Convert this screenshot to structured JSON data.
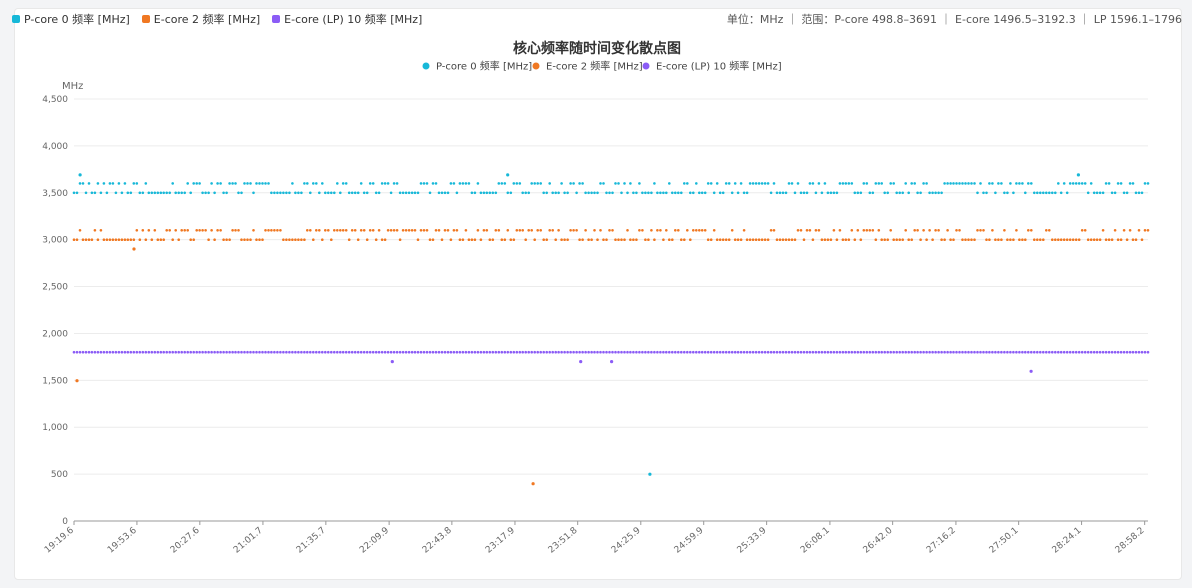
{
  "top_legend": [
    {
      "label": "P-core 0 频率 [MHz]",
      "color": "#17b8d8"
    },
    {
      "label": "E-core 2 频率 [MHz]",
      "color": "#f07822"
    },
    {
      "label": "E-core (LP) 10 频率 [MHz]",
      "color": "#8b5cf6"
    }
  ],
  "range_info": "单位：MHz ｜ 范围：P-core 498.8–3691 ｜ E-core 1496.5–3192.3 ｜ LP 1596.1–1796",
  "chart_data": {
    "type": "scatter",
    "title": "核心频率随时间变化散点图",
    "ylabel": "MHz",
    "xlabel": "",
    "ylim": [
      0,
      4500
    ],
    "yticks": [
      "0",
      "500",
      "1,000",
      "1,500",
      "2,000",
      "2,500",
      "3,000",
      "3,500",
      "4,000",
      "4,500"
    ],
    "xticks": [
      "19:19.6",
      "19:53.6",
      "20:27.6",
      "21:01.7",
      "21:35.7",
      "22:09.9",
      "22:43.8",
      "23:17.9",
      "23:51.8",
      "24:25.9",
      "24:59.9",
      "25:33.9",
      "26:08.1",
      "26:42.0",
      "27:16.2",
      "27:50.1",
      "28:24.1",
      "28:58.2"
    ],
    "x_range": [
      "19:19.6",
      "29:00.0"
    ],
    "point_count": 360,
    "grid": true,
    "legend": "top",
    "series": [
      {
        "name": "P-core 0 频率 [MHz]",
        "color": "#17b8d8",
        "baseline": [
          3500,
          3600
        ],
        "outliers": [
          {
            "x": "19:22.9",
            "y": 3691
          },
          {
            "x": "23:14.0",
            "y": 3691
          },
          {
            "x": "28:22.4",
            "y": 3691
          },
          {
            "x": "24:30.8",
            "y": 498.8
          }
        ]
      },
      {
        "name": "E-core 2 频率 [MHz]",
        "color": "#f07822",
        "baseline": [
          3000,
          3100
        ],
        "outliers": [
          {
            "x": "19:21.2",
            "y": 1496.5
          },
          {
            "x": "19:52.0",
            "y": 2900
          },
          {
            "x": "23:27.7",
            "y": 398
          }
        ]
      },
      {
        "name": "E-core (LP) 10 频率 [MHz]",
        "color": "#8b5cf6",
        "baseline": [
          1800
        ],
        "outliers": [
          {
            "x": "22:11.6",
            "y": 1700
          },
          {
            "x": "23:53.4",
            "y": 1700
          },
          {
            "x": "24:10.1",
            "y": 1700
          },
          {
            "x": "27:56.8",
            "y": 1596.1
          }
        ]
      }
    ]
  }
}
